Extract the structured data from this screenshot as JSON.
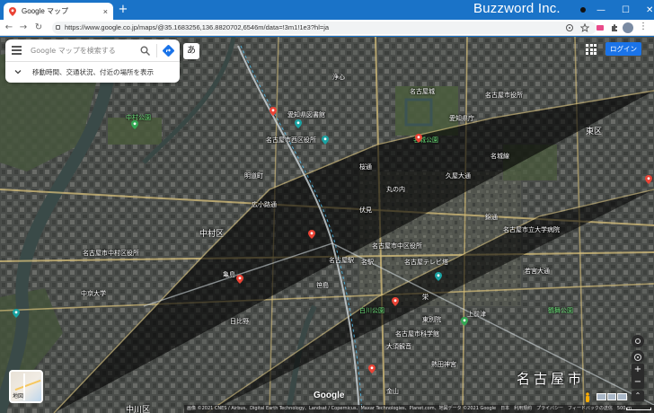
{
  "browser": {
    "tab_title": "Google マップ",
    "tab_close": "×",
    "new_tab": "+",
    "brand": "Buzzword Inc.",
    "window_controls": [
      "—",
      "☐",
      "✕"
    ],
    "url": "https://www.google.co.jp/maps/@35.1683256,136.8820702,6546m/data=!3m1!1e3?hl=ja"
  },
  "search": {
    "placeholder": "Google マップを検索する",
    "hint": "移動時間、交通状況、付近の場所を表示",
    "ime_button": "あ"
  },
  "header_right": {
    "login": "ログイン"
  },
  "map": {
    "ward_labels": [
      {
        "text": "中村区",
        "cls": "med"
      },
      {
        "text": "東区",
        "cls": "med"
      },
      {
        "text": "名古屋市",
        "cls": "big"
      },
      {
        "text": "中川区",
        "cls": "med"
      }
    ],
    "place_labels": [
      "名古屋城",
      "名古屋駅",
      "愛知県図書館",
      "名城公園",
      "名古屋市役所",
      "名古屋市立大学病院",
      "中村公園",
      "大須観音",
      "栄",
      "白川公園",
      "名古屋テレビ塔",
      "久屋大通",
      "名城線",
      "桜通",
      "錦通",
      "広小路通",
      "名駅",
      "名古屋市中村区役所",
      "中京大学",
      "東別院",
      "上前津",
      "鶴舞公園",
      "名古屋市科学館",
      "若宮大通",
      "伏見",
      "丸の内",
      "愛知県庁",
      "浄心",
      "名古屋市中区役所",
      "笹島",
      "亀島",
      "名古屋市西区役所",
      "明道町",
      "日比野",
      "金山",
      "熱田神宮"
    ],
    "layer_thumb": "地図",
    "zoom_in": "+",
    "zoom_out": "−",
    "expand": "⌃",
    "logo": "Google",
    "attribution": "画像 ©2021 CNES / Airbus、Digital Earth Technology、Landsat / Copernicus、Maxar Technologies、Planet.com、地図データ ©2021 Google　日本　利用規約　プライバシー　フィードバックの送信　500 m"
  },
  "colors": {
    "browser_blue": "#1a73c8",
    "login_blue": "#1a73e8",
    "road_yellow": "#f0c040",
    "pin_red": "#ea4335",
    "pin_teal": "#1aa3a3",
    "pin_green": "#34a853"
  }
}
